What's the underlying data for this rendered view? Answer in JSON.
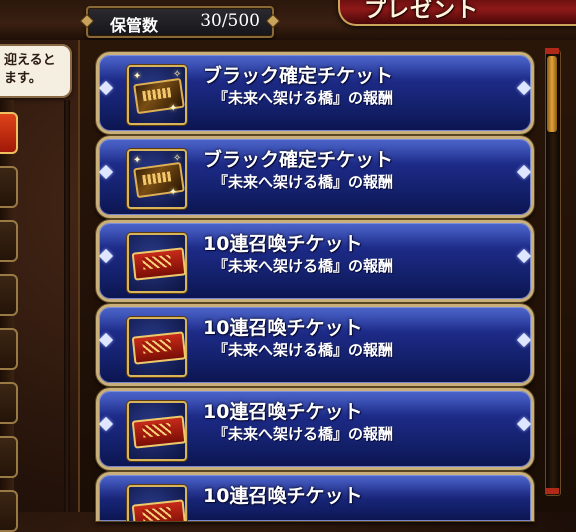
{
  "header": {
    "storage_label": "保管数",
    "storage_value": "30/500",
    "title": "プレゼント"
  },
  "speech_bubble": {
    "text": "迎えると\nます。"
  },
  "items": [
    {
      "name": "ブラック確定チケット",
      "desc": "『未来へ架ける橋』の報酬",
      "icon": "black-ticket-icon"
    },
    {
      "name": "ブラック確定チケット",
      "desc": "『未来へ架ける橋』の報酬",
      "icon": "black-ticket-icon"
    },
    {
      "name": "10連召喚チケット",
      "desc": "『未来へ架ける橋』の報酬",
      "icon": "summon-ticket-icon"
    },
    {
      "name": "10連召喚チケット",
      "desc": "『未来へ架ける橋』の報酬",
      "icon": "summon-ticket-icon"
    },
    {
      "name": "10連召喚チケット",
      "desc": "『未来へ架ける橋』の報酬",
      "icon": "summon-ticket-icon"
    },
    {
      "name": "10連召喚チケット",
      "desc": "",
      "icon": "summon-ticket-icon"
    }
  ],
  "colors": {
    "item_blue": "#1d2a86",
    "gold_frame": "#c9b07a",
    "title_red": "#8e1818"
  }
}
